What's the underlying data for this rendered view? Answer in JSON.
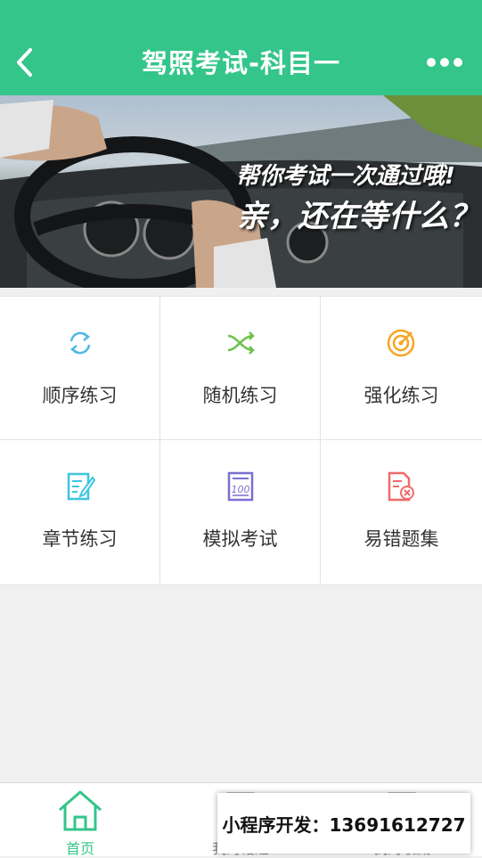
{
  "header": {
    "title": "驾照考试-科目一",
    "back_icon": "chevron-left-icon",
    "more_icon": "more-dots-icon",
    "background": "#34c58a"
  },
  "banner": {
    "line1": "帮你考试一次通过哦!",
    "line2": "亲，还在等什么？"
  },
  "menu": [
    {
      "label": "顺序练习",
      "icon": "cycle-arrows-icon",
      "color": "#4fb8e8"
    },
    {
      "label": "随机练习",
      "icon": "shuffle-icon",
      "color": "#6cc24a"
    },
    {
      "label": "强化练习",
      "icon": "target-icon",
      "color": "#f5a623"
    },
    {
      "label": "章节练习",
      "icon": "edit-document-icon",
      "color": "#3dc6e0"
    },
    {
      "label": "模拟考试",
      "icon": "score-100-icon",
      "color": "#7a6fd1"
    },
    {
      "label": "易错题集",
      "icon": "document-error-icon",
      "color": "#f06a6a"
    }
  ],
  "tabbar": {
    "tabs": [
      {
        "label": "首页",
        "icon": "home-icon",
        "active": true
      },
      {
        "label": "我的错题",
        "icon": "book-icon",
        "active": false
      },
      {
        "label": "我的收藏",
        "icon": "star-icon",
        "active": false
      }
    ],
    "active_color": "#34c58a"
  },
  "promo": {
    "text": "小程序开发：13691612727"
  }
}
